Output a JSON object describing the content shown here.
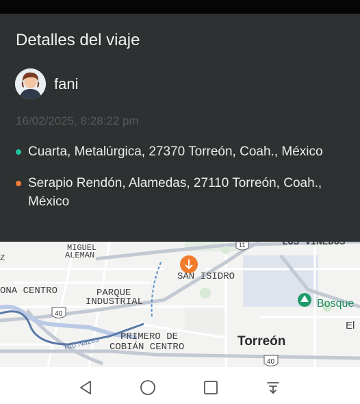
{
  "panel": {
    "title": "Detalles del viaje",
    "username": "fani",
    "timestamp": "16/02/2025, 8:28:22 pm",
    "origin": {
      "address": "Cuarta, Metalúrgica, 27370 Torreón, Coah., México",
      "dot_color": "#1fbf9f"
    },
    "destination": {
      "address": "Serapio Rendón, Alamedas, 27110 Torreón, Coah., México",
      "dot_color": "#f07c3a"
    },
    "colors": {
      "background": "#2e3131",
      "text": "#ededed",
      "muted": "#575a5a"
    }
  },
  "map": {
    "labels": {
      "miguel": "MIGUEL",
      "aleman": "ALEMAN",
      "los_vinedos": "LOS VIÑEDOS",
      "z": "Z",
      "san_isidro": "SAN ISIDRO",
      "ona_centro": "ONA CENTRO",
      "parque": "PARQUE",
      "industrial": "INDUSTRIAL",
      "bosque": "Bosque",
      "el": "El",
      "rio_nazas": "Río Nazas",
      "primero_de": "PRIMERO DE",
      "cobian_centro": "COBIÁN CENTRO",
      "torreon": "Torreón"
    },
    "shields": {
      "route_11": "11",
      "route_40_left": "40",
      "route_40_bottom": "40"
    },
    "icons": {
      "pin": "orange-arrow-down-pin",
      "park": "green-tree-pin"
    }
  },
  "nav": {
    "back": "back-triangle-icon",
    "home": "home-circle-icon",
    "recents": "recents-square-icon",
    "menu": "menu-download-icon"
  }
}
